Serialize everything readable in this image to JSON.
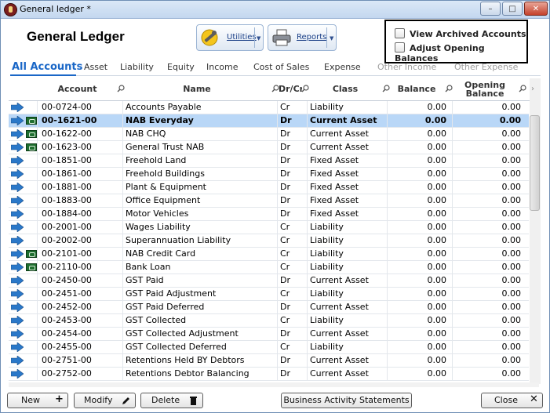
{
  "window": {
    "title": "General ledger *"
  },
  "header": {
    "title": "General Ledger"
  },
  "toolbar": {
    "utilities_label": "Utilities",
    "reports_label": "Reports"
  },
  "options": [
    {
      "label": "View Archived Accounts",
      "checked": false
    },
    {
      "label": "Adjust Opening Balances",
      "checked": false
    }
  ],
  "tabs": [
    {
      "label": "All Accounts",
      "active": true
    },
    {
      "label": "Asset"
    },
    {
      "label": "Liability"
    },
    {
      "label": "Equity"
    },
    {
      "label": "Income"
    },
    {
      "label": "Cost of Sales"
    },
    {
      "label": "Expense"
    },
    {
      "label": "Other Income"
    },
    {
      "label": "Other Expense"
    }
  ],
  "columns": {
    "account": "Account",
    "name": "Name",
    "drcr": "Dr/Cr",
    "class": "Class",
    "balance": "Balance",
    "opening_line1": "Opening",
    "opening_line2": "Balance"
  },
  "rows": [
    {
      "account": "00-0724-00",
      "name": "Accounts Payable",
      "drcr": "Cr",
      "class": "Liability",
      "balance": "0.00",
      "opening": "0.00",
      "bank": false
    },
    {
      "account": "00-1621-00",
      "name": "NAB Everyday",
      "drcr": "Dr",
      "class": "Current Asset",
      "balance": "0.00",
      "opening": "0.00",
      "bank": true,
      "selected": true
    },
    {
      "account": "00-1622-00",
      "name": "NAB CHQ",
      "drcr": "Dr",
      "class": "Current Asset",
      "balance": "0.00",
      "opening": "0.00",
      "bank": true
    },
    {
      "account": "00-1623-00",
      "name": "General Trust NAB",
      "drcr": "Dr",
      "class": "Current Asset",
      "balance": "0.00",
      "opening": "0.00",
      "bank": true
    },
    {
      "account": "00-1851-00",
      "name": "Freehold Land",
      "drcr": "Dr",
      "class": "Fixed Asset",
      "balance": "0.00",
      "opening": "0.00",
      "bank": false
    },
    {
      "account": "00-1861-00",
      "name": "Freehold Buildings",
      "drcr": "Dr",
      "class": "Fixed Asset",
      "balance": "0.00",
      "opening": "0.00",
      "bank": false
    },
    {
      "account": "00-1881-00",
      "name": "Plant & Equipment",
      "drcr": "Dr",
      "class": "Fixed Asset",
      "balance": "0.00",
      "opening": "0.00",
      "bank": false
    },
    {
      "account": "00-1883-00",
      "name": "Office Equipment",
      "drcr": "Dr",
      "class": "Fixed Asset",
      "balance": "0.00",
      "opening": "0.00",
      "bank": false
    },
    {
      "account": "00-1884-00",
      "name": "Motor Vehicles",
      "drcr": "Dr",
      "class": "Fixed Asset",
      "balance": "0.00",
      "opening": "0.00",
      "bank": false
    },
    {
      "account": "00-2001-00",
      "name": "Wages Liability",
      "drcr": "Cr",
      "class": "Liability",
      "balance": "0.00",
      "opening": "0.00",
      "bank": false
    },
    {
      "account": "00-2002-00",
      "name": "Superannuation Liability",
      "drcr": "Cr",
      "class": "Liability",
      "balance": "0.00",
      "opening": "0.00",
      "bank": false
    },
    {
      "account": "00-2101-00",
      "name": "NAB Credit Card",
      "drcr": "Cr",
      "class": "Liability",
      "balance": "0.00",
      "opening": "0.00",
      "bank": true
    },
    {
      "account": "00-2110-00",
      "name": "Bank Loan",
      "drcr": "Cr",
      "class": "Liability",
      "balance": "0.00",
      "opening": "0.00",
      "bank": true
    },
    {
      "account": "00-2450-00",
      "name": "GST Paid",
      "drcr": "Dr",
      "class": "Current Asset",
      "balance": "0.00",
      "opening": "0.00",
      "bank": false
    },
    {
      "account": "00-2451-00",
      "name": "GST Paid Adjustment",
      "drcr": "Cr",
      "class": "Liability",
      "balance": "0.00",
      "opening": "0.00",
      "bank": false
    },
    {
      "account": "00-2452-00",
      "name": "GST Paid Deferred",
      "drcr": "Dr",
      "class": "Current Asset",
      "balance": "0.00",
      "opening": "0.00",
      "bank": false
    },
    {
      "account": "00-2453-00",
      "name": "GST Collected",
      "drcr": "Cr",
      "class": "Liability",
      "balance": "0.00",
      "opening": "0.00",
      "bank": false
    },
    {
      "account": "00-2454-00",
      "name": "GST Collected Adjustment",
      "drcr": "Dr",
      "class": "Current Asset",
      "balance": "0.00",
      "opening": "0.00",
      "bank": false
    },
    {
      "account": "00-2455-00",
      "name": "GST Collected Deferred",
      "drcr": "Cr",
      "class": "Liability",
      "balance": "0.00",
      "opening": "0.00",
      "bank": false
    },
    {
      "account": "00-2751-00",
      "name": "Retentions Held BY Debtors",
      "drcr": "Dr",
      "class": "Current Asset",
      "balance": "0.00",
      "opening": "0.00",
      "bank": false
    },
    {
      "account": "00-2752-00",
      "name": "Retentions Debtor Balancing",
      "drcr": "Dr",
      "class": "Current Asset",
      "balance": "0.00",
      "opening": "0.00",
      "bank": false
    }
  ],
  "buttons": {
    "new": "New",
    "modify": "Modify",
    "delete": "Delete",
    "bas": "Business Activity Statements",
    "close": "Close"
  },
  "colors": {
    "accent": "#1a67c7",
    "selection": "#b9d7f7"
  }
}
